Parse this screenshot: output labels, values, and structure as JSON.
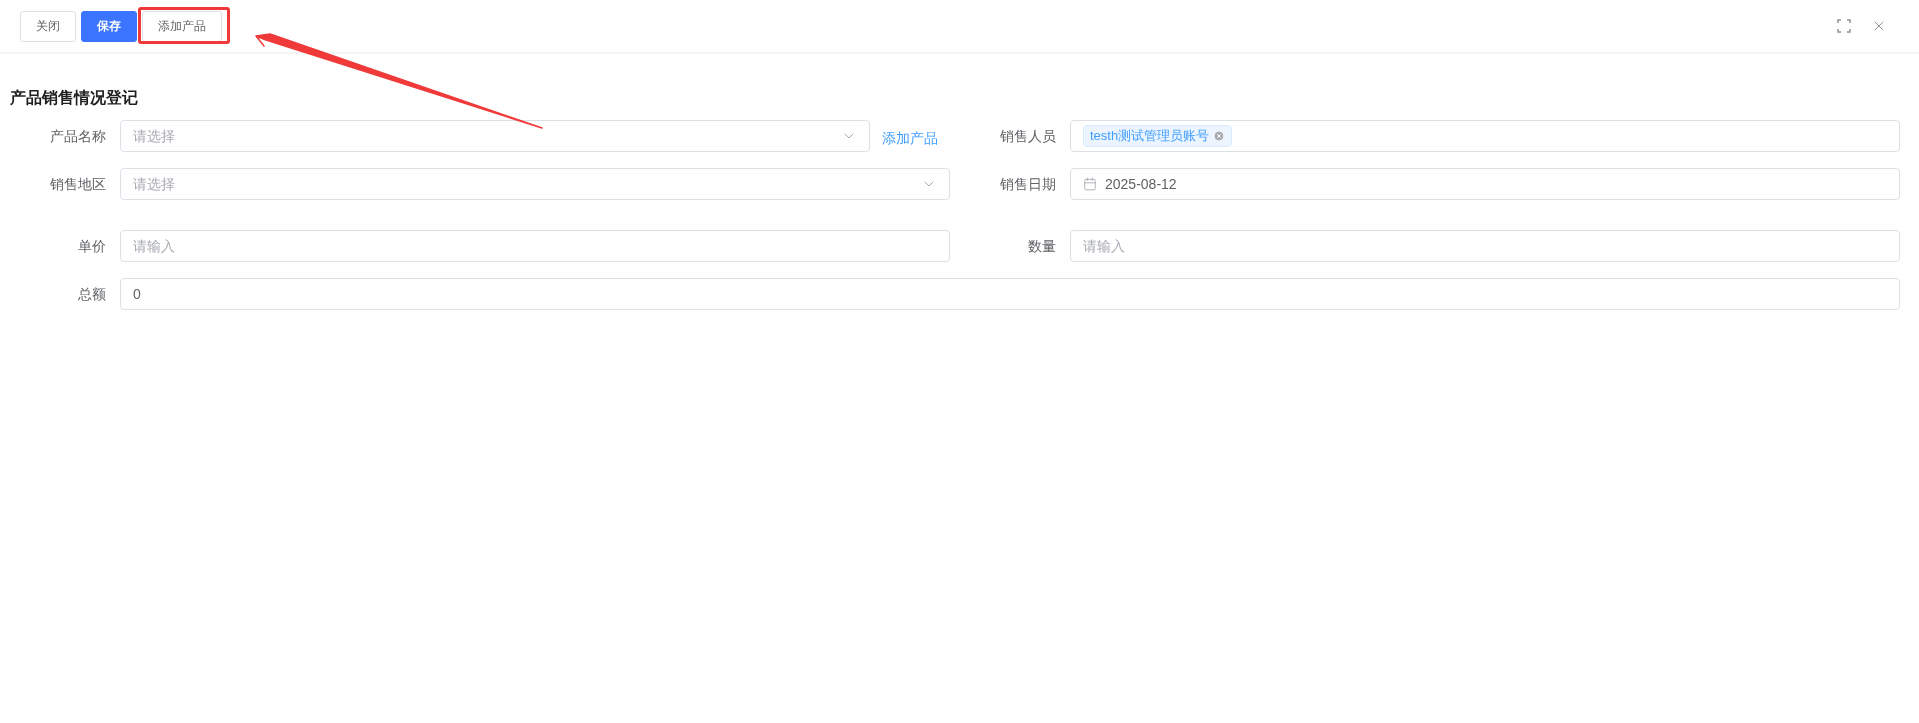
{
  "toolbar": {
    "buttons": [
      {
        "label": "关闭",
        "kind": "default",
        "highlighted": false
      },
      {
        "label": "保存",
        "kind": "primary",
        "highlighted": false
      },
      {
        "label": "添加产品",
        "kind": "default",
        "highlighted": true
      }
    ]
  },
  "title": "产品销售情况登记",
  "rows": [
    {
      "fields": [
        {
          "label": "产品名称",
          "kind": "select",
          "placeholder": "请选择",
          "link": "添加产品"
        },
        {
          "label": "销售人员",
          "kind": "tags",
          "tags": [
            "testh测试管理员账号"
          ]
        }
      ]
    },
    {
      "fields": [
        {
          "label": "销售地区",
          "kind": "select",
          "placeholder": "请选择"
        },
        {
          "label": "销售日期",
          "kind": "date",
          "value": "2025-08-12"
        }
      ]
    },
    {
      "fields": [
        {
          "label": "单价",
          "kind": "input",
          "placeholder": "请输入"
        },
        {
          "label": "数量",
          "kind": "input",
          "placeholder": "请输入"
        }
      ]
    },
    {
      "fields": [
        {
          "label": "总额",
          "kind": "input",
          "value": "0"
        }
      ]
    }
  ]
}
